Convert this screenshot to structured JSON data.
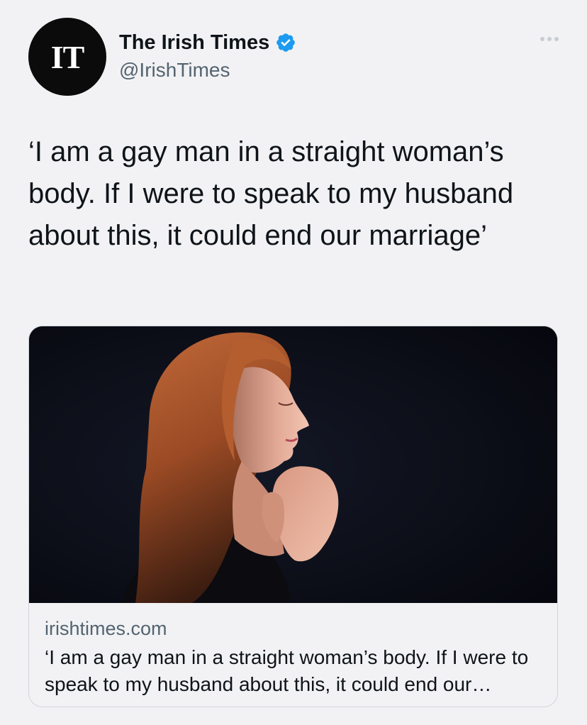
{
  "account": {
    "avatar_text": "IT",
    "display_name": "The Irish Times",
    "handle": "@IrishTimes",
    "verified": true
  },
  "tweet": {
    "text": "‘I am a gay man in a straight woman’s body. If I were to speak to my husband about this, it could end our marriage’"
  },
  "card": {
    "image_icon": "woman-praying-photo",
    "domain": "irishtimes.com",
    "title": "‘I am a gay man in a straight woman’s body. If I were to speak to my husband about this, it could end our marriage’"
  },
  "icons": {
    "verified": "verified-badge-icon",
    "more": "more-options-icon"
  },
  "colors": {
    "verified_blue": "#1d9bf0",
    "background": "#f2f2f4",
    "secondary_text": "#536471"
  }
}
